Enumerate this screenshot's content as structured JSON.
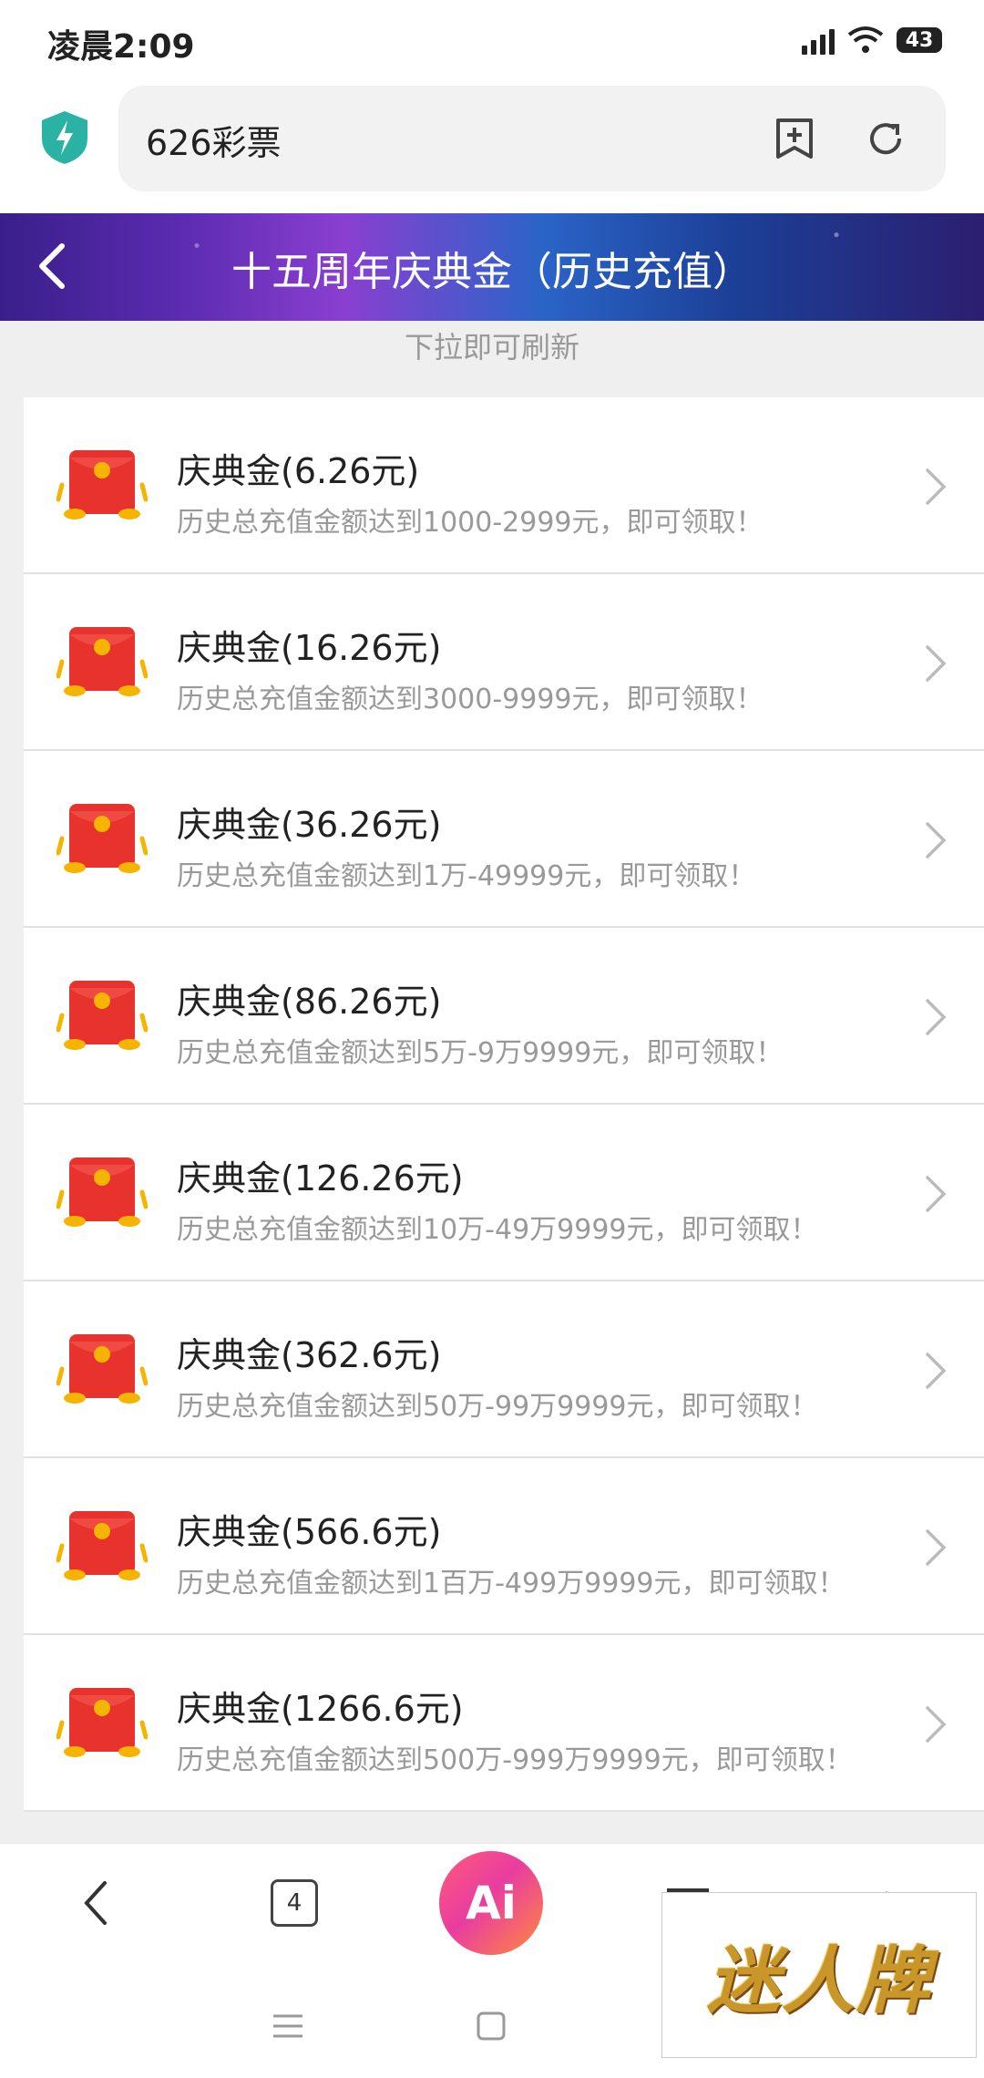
{
  "status_bar": {
    "time": "凌晨2:09",
    "battery": "43"
  },
  "browser": {
    "url_text": "626彩票"
  },
  "banner": {
    "title": "十五周年庆典金（历史充值）"
  },
  "pull_hint": "下拉即可刷新",
  "items": [
    {
      "title": "庆典金(6.26元)",
      "subtitle": "历史总充值金额达到1000-2999元，即可领取！"
    },
    {
      "title": "庆典金(16.26元)",
      "subtitle": "历史总充值金额达到3000-9999元，即可领取！"
    },
    {
      "title": "庆典金(36.26元)",
      "subtitle": "历史总充值金额达到1万-49999元，即可领取！"
    },
    {
      "title": "庆典金(86.26元)",
      "subtitle": "历史总充值金额达到5万-9万9999元，即可领取！"
    },
    {
      "title": "庆典金(126.26元)",
      "subtitle": "历史总充值金额达到10万-49万9999元，即可领取！"
    },
    {
      "title": "庆典金(362.6元)",
      "subtitle": "历史总充值金额达到50万-99万9999元，即可领取！"
    },
    {
      "title": "庆典金(566.6元)",
      "subtitle": "历史总充值金额达到1百万-499万9999元，即可领取！"
    },
    {
      "title": "庆典金(1266.6元)",
      "subtitle": "历史总充值金额达到500万-999万9999元，即可领取！"
    }
  ],
  "bottom_nav": {
    "tab_count": "4",
    "ai_label": "Ai"
  },
  "watermark": "迷人牌",
  "colors": {
    "envelope": "#e8322e",
    "gold": "#f5b400",
    "shield": "#2ab3a5"
  },
  "icons": [
    "shield-bolt-icon",
    "bookmark-add-icon",
    "refresh-icon",
    "back-arrow-icon",
    "red-envelope-icon",
    "chevron-right-icon",
    "tabs-icon",
    "menu-icon",
    "home-icon"
  ]
}
